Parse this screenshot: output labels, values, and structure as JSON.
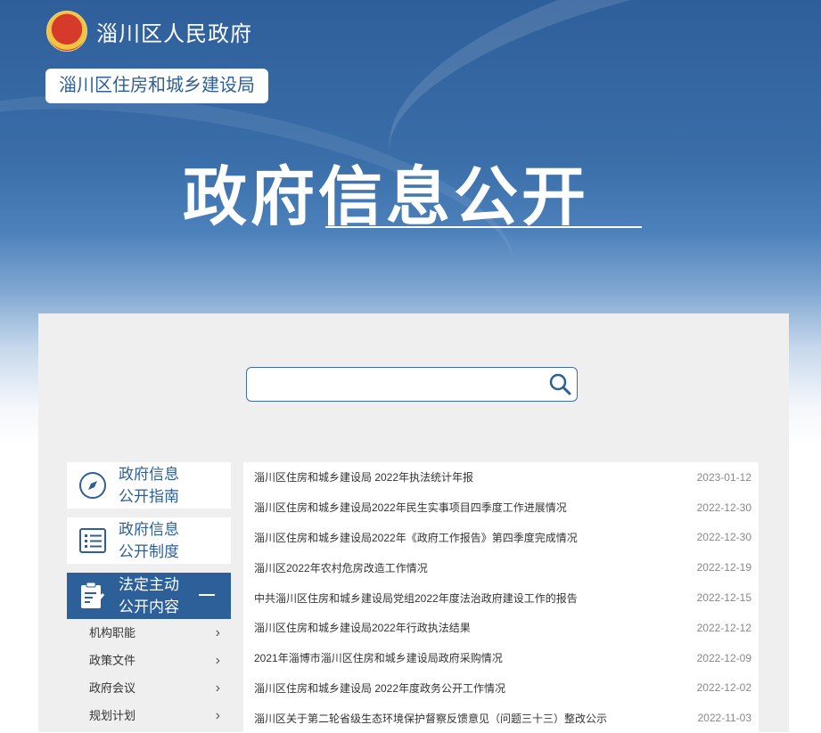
{
  "header": {
    "site_name": "淄川区人民政府",
    "department": "淄川区住房和城乡建设局",
    "page_title": "政府信息公开"
  },
  "search": {
    "placeholder": "",
    "value": ""
  },
  "sidebar": {
    "cards": [
      {
        "label_line1": "政府信息",
        "label_line2": "公开指南",
        "icon": "compass-icon"
      },
      {
        "label_line1": "政府信息",
        "label_line2": "公开制度",
        "icon": "list-icon"
      },
      {
        "label_line1": "法定主动",
        "label_line2": "公开内容",
        "icon": "edit-document-icon",
        "active": true
      }
    ],
    "sub_items": [
      {
        "label": "机构职能"
      },
      {
        "label": "政策文件"
      },
      {
        "label": "政府会议"
      },
      {
        "label": "规划计划"
      }
    ]
  },
  "articles": [
    {
      "title": "淄川区住房和城乡建设局 2022年执法统计年报",
      "date": "2023-01-12"
    },
    {
      "title": "淄川区住房和城乡建设局2022年民生实事项目四季度工作进展情况",
      "date": "2022-12-30"
    },
    {
      "title": "淄川区住房和城乡建设局2022年《政府工作报告》第四季度完成情况",
      "date": "2022-12-30"
    },
    {
      "title": "淄川区2022年农村危房改造工作情况",
      "date": "2022-12-19"
    },
    {
      "title": "中共淄川区住房和城乡建设局党组2022年度法治政府建设工作的报告",
      "date": "2022-12-15"
    },
    {
      "title": "淄川区住房和城乡建设局2022年行政执法结果",
      "date": "2022-12-12"
    },
    {
      "title": "2021年淄博市淄川区住房和城乡建设局政府采购情况",
      "date": "2022-12-09"
    },
    {
      "title": "淄川区住房和城乡建设局 2022年度政务公开工作情况",
      "date": "2022-12-02"
    },
    {
      "title": "淄川区关于第二轮省级生态环境保护督察反馈意见（问题三十三）整改公示",
      "date": "2022-11-03"
    }
  ],
  "colors": {
    "brand_blue": "#2d5f99",
    "panel_gray": "#efefef"
  }
}
